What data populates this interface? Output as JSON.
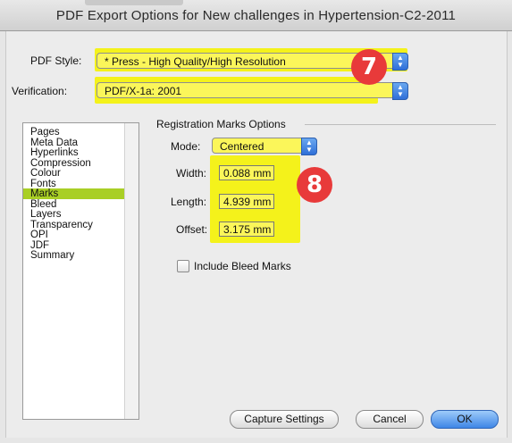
{
  "window": {
    "title": "PDF Export Options for New challenges in Hypertension-C2-2011"
  },
  "pdf_style": {
    "label": "PDF Style:",
    "value": "* Press - High Quality/High Resolution"
  },
  "verification": {
    "label": "Verification:",
    "value": "PDF/X-1a: 2001"
  },
  "badges": {
    "first": "7",
    "second": "8"
  },
  "sidebar": {
    "items": [
      {
        "label": "Pages",
        "selected": false
      },
      {
        "label": "Meta Data",
        "selected": false
      },
      {
        "label": "Hyperlinks",
        "selected": false
      },
      {
        "label": "Compression",
        "selected": false
      },
      {
        "label": "Colour",
        "selected": false
      },
      {
        "label": "Fonts",
        "selected": false
      },
      {
        "label": "Marks",
        "selected": true
      },
      {
        "label": "Bleed",
        "selected": false
      },
      {
        "label": "Layers",
        "selected": false
      },
      {
        "label": "Transparency",
        "selected": false
      },
      {
        "label": "OPI",
        "selected": false
      },
      {
        "label": "JDF",
        "selected": false
      },
      {
        "label": "Summary",
        "selected": false
      }
    ]
  },
  "registration": {
    "group_title": "Registration Marks Options",
    "mode_label": "Mode:",
    "mode_value": "Centered",
    "width_label": "Width:",
    "width_value": "0.088 mm",
    "length_label": "Length:",
    "length_value": "4.939 mm",
    "offset_label": "Offset:",
    "offset_value": "3.175 mm",
    "include_bleed_label": "Include Bleed Marks",
    "include_bleed_checked": false
  },
  "buttons": {
    "capture": "Capture Settings",
    "cancel": "Cancel",
    "ok": "OK"
  },
  "colors": {
    "highlight": "#f4f21b",
    "selection": "#a9cf25",
    "badge": "#e83a3a",
    "accent": "#3f86e6"
  }
}
